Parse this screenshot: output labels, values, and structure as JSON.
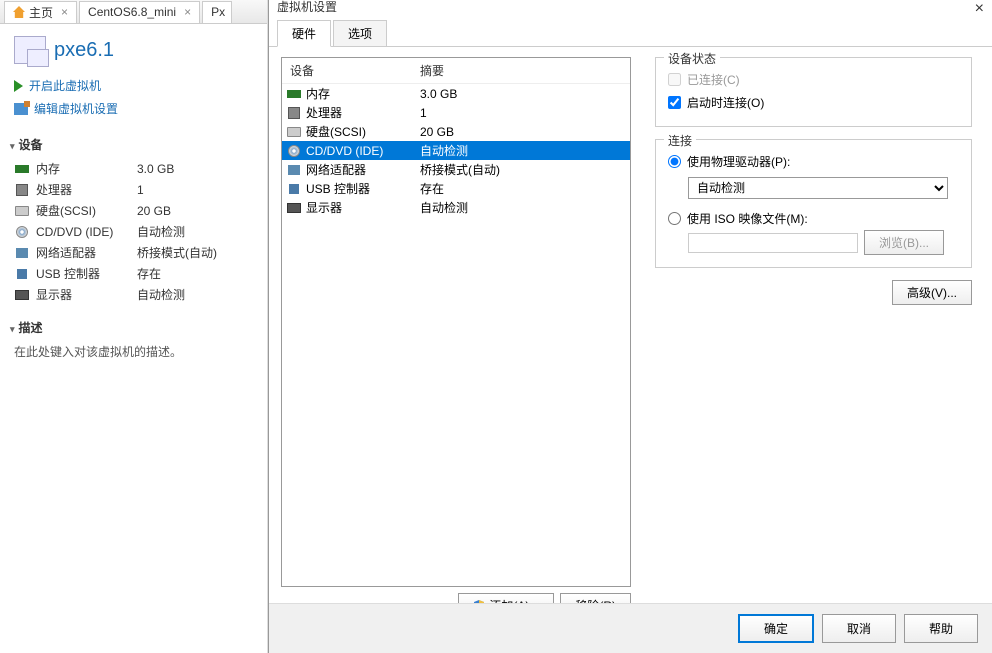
{
  "tabs": {
    "home": "主页",
    "mini": "CentOS6.8_mini",
    "px": "Px"
  },
  "vm": {
    "name": "pxe6.1",
    "power_on": "开启此虚拟机",
    "edit_settings": "编辑虚拟机设置"
  },
  "sidebar": {
    "devices_header": "设备",
    "devices": [
      {
        "label": "内存",
        "value": "3.0 GB"
      },
      {
        "label": "处理器",
        "value": "1"
      },
      {
        "label": "硬盘(SCSI)",
        "value": "20 GB"
      },
      {
        "label": "CD/DVD (IDE)",
        "value": "自动检测"
      },
      {
        "label": "网络适配器",
        "value": "桥接模式(自动)"
      },
      {
        "label": "USB 控制器",
        "value": "存在"
      },
      {
        "label": "显示器",
        "value": "自动检测"
      }
    ],
    "desc_header": "描述",
    "desc_text": "在此处键入对该虚拟机的描述。"
  },
  "dialog": {
    "title": "虚拟机设置",
    "close": "×",
    "tab_hardware": "硬件",
    "tab_options": "选项",
    "col_device": "设备",
    "col_summary": "摘要",
    "hardware": [
      {
        "label": "内存",
        "value": "3.0 GB"
      },
      {
        "label": "处理器",
        "value": "1"
      },
      {
        "label": "硬盘(SCSI)",
        "value": "20 GB"
      },
      {
        "label": "CD/DVD (IDE)",
        "value": "自动检测"
      },
      {
        "label": "网络适配器",
        "value": "桥接模式(自动)"
      },
      {
        "label": "USB 控制器",
        "value": "存在"
      },
      {
        "label": "显示器",
        "value": "自动检测"
      }
    ],
    "add": "添加(A)...",
    "remove": "移除(R)",
    "status_group": "设备状态",
    "connected": "已连接(C)",
    "connect_poweron": "启动时连接(O)",
    "connection_group": "连接",
    "use_physical": "使用物理驱动器(P):",
    "auto_detect": "自动检测",
    "use_iso": "使用 ISO 映像文件(M):",
    "browse": "浏览(B)...",
    "advanced": "高级(V)...",
    "ok": "确定",
    "cancel": "取消",
    "help": "帮助"
  }
}
